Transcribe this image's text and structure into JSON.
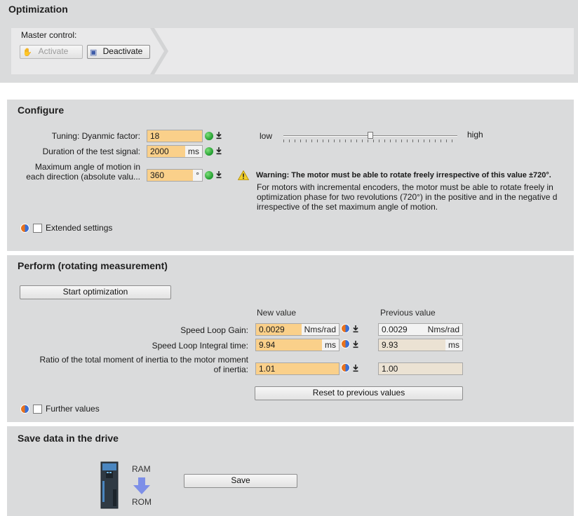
{
  "optimization": {
    "title": "Optimization",
    "master_control_label": "Master control:",
    "activate_label": "Activate",
    "deactivate_label": "Deactivate"
  },
  "configure": {
    "title": "Configure",
    "dynamic_factor_label": "Tuning: Dyanmic factor:",
    "dynamic_factor_value": "18",
    "duration_label": "Duration of the test signal:",
    "duration_value": "2000",
    "duration_unit": "ms",
    "max_angle_label_1": "Maximum angle of motion in",
    "max_angle_label_2": "each direction (absolute valu...",
    "max_angle_value": "360",
    "max_angle_unit": "°",
    "slider_low": "low",
    "slider_high": "high",
    "slider_fraction": 0.5,
    "warning_bold": "Warning: The motor must be able to rotate freely irrespective of this value ±720°.",
    "warning_line1": "For motors with incremental encoders, the motor must be able to rotate freely in",
    "warning_line2": "optimization phase for two revolutions (720°) in the positive and in the negative d",
    "warning_line3": "irrespective of the set maximum angle of motion.",
    "extended_settings_label": "Extended settings"
  },
  "perform": {
    "title": "Perform (rotating measurement)",
    "start_label": "Start optimization",
    "new_value_header": "New value",
    "previous_value_header": "Previous value",
    "rows": [
      {
        "label": "Speed Loop Gain:",
        "new_value": "0.0029",
        "new_unit": "Nms/rad",
        "prev_value": "0.0029",
        "prev_unit": "Nms/rad"
      },
      {
        "label": "Speed Loop Integral time:",
        "new_value": "9.94",
        "new_unit": "ms",
        "prev_value": "9.93",
        "prev_unit": "ms"
      },
      {
        "label_1": "Ratio of the total moment of inertia to the motor moment",
        "label_2": "of inertia:",
        "new_value": "1.01",
        "prev_value": "1.00"
      }
    ],
    "reset_label": "Reset to previous values",
    "further_values_label": "Further values"
  },
  "save": {
    "title": "Save data in the drive",
    "ram_label": "RAM",
    "rom_label": "ROM",
    "save_label": "Save"
  },
  "colors": {
    "panel": "#dadbdc",
    "input_active": "#fad08a",
    "input_previous": "#ebe2d3",
    "status_ok": "#1e9a2c",
    "arrow": "#7d8fe8"
  }
}
